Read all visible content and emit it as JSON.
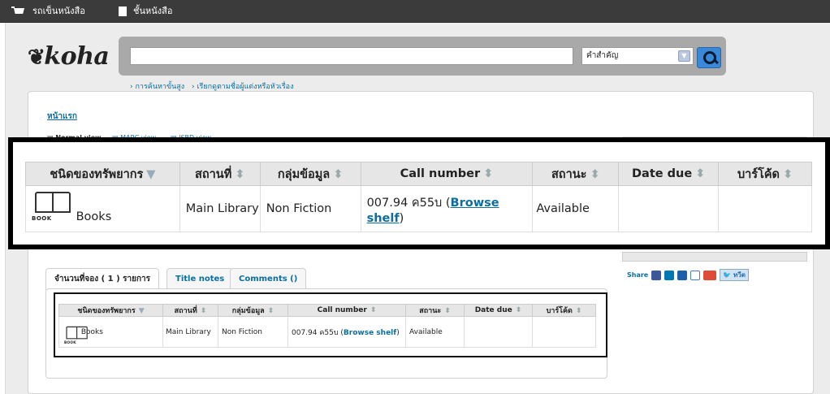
{
  "topbar": {
    "cart_label": "รถเข็นหนังสือ",
    "lists_label": "ชั้นหนังสือ"
  },
  "logo": {
    "text": "koha"
  },
  "search": {
    "input_value": "",
    "select_value": "คำสำคัญ"
  },
  "links": {
    "advanced_search": "การค้นหาขั้นสูง",
    "browse_authors": "เรียกดูตามชื่อผู้แต่งหรือหัวเรื่อง",
    "home": "หน้าแรก"
  },
  "views": {
    "normal": "Normal view",
    "marc": "MARC view",
    "isbd": "ISBD view"
  },
  "tabs": [
    {
      "label": "จำนวนที่จอง ( 1 ) รายการ"
    },
    {
      "label": "Title notes"
    },
    {
      "label": "Comments ()"
    }
  ],
  "share": {
    "label": "Share",
    "tweet": "ทวีต"
  },
  "holdings": {
    "headers": [
      "ชนิดของทรัพยากร",
      "สถานที่",
      "กลุ่มข้อมูล",
      "Call number",
      "สถานะ",
      "Date due",
      "บาร์โค้ด"
    ],
    "rows": [
      {
        "icon_label": "BOOK",
        "itemtype": "Books",
        "location": "Main Library",
        "collection": "Non Fiction",
        "callnumber": "007.94 ค55บ",
        "browse_link": "Browse shelf",
        "status": "Available",
        "date_due": "",
        "barcode": ""
      }
    ]
  }
}
